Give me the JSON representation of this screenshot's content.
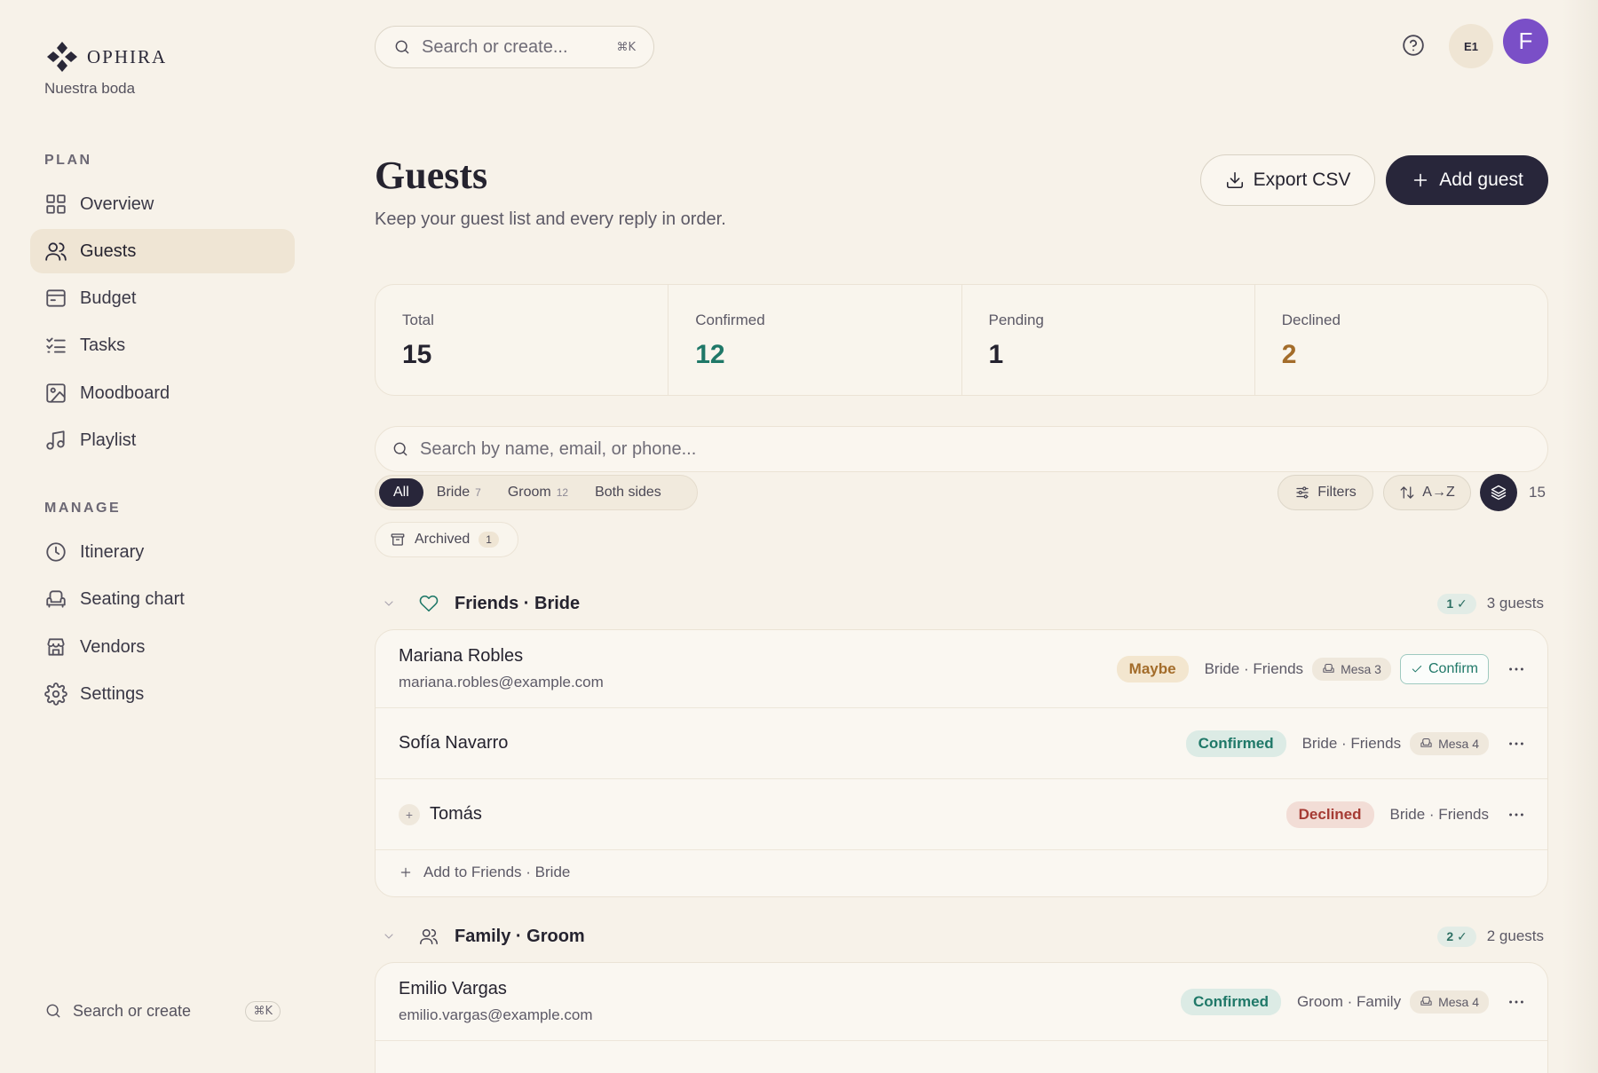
{
  "brand": {
    "name": "OPHIRA",
    "subtitle": "Nuestra boda"
  },
  "sidebar": {
    "plan_label": "PLAN",
    "manage_label": "MANAGE",
    "plan_items": [
      {
        "label": "Overview",
        "icon": "grid-icon"
      },
      {
        "label": "Guests",
        "icon": "users-icon",
        "active": true
      },
      {
        "label": "Budget",
        "icon": "wallet-icon"
      },
      {
        "label": "Tasks",
        "icon": "checklist-icon"
      },
      {
        "label": "Moodboard",
        "icon": "image-icon"
      },
      {
        "label": "Playlist",
        "icon": "music-icon"
      }
    ],
    "manage_items": [
      {
        "label": "Itinerary",
        "icon": "clock-icon"
      },
      {
        "label": "Seating chart",
        "icon": "armchair-icon"
      },
      {
        "label": "Vendors",
        "icon": "store-icon"
      },
      {
        "label": "Settings",
        "icon": "gear-icon"
      }
    ],
    "search_label": "Search or create",
    "search_shortcut": "⌘K"
  },
  "topbar": {
    "search_placeholder": "Search or create...",
    "search_shortcut": "⌘K",
    "workspace_badge": "E1",
    "avatar_initial": "F",
    "avatar_color": "#7a4fc7"
  },
  "header": {
    "title": "Guests",
    "subtitle": "Keep your guest list and every reply in order.",
    "export_label": "Export CSV",
    "add_label": "Add guest"
  },
  "stats": [
    {
      "label": "Total",
      "value": "15",
      "color": "#25232f"
    },
    {
      "label": "Confirmed",
      "value": "12",
      "color": "#1f7868"
    },
    {
      "label": "Pending",
      "value": "1",
      "color": "#25232f"
    },
    {
      "label": "Declined",
      "value": "2",
      "color": "#a36c2a"
    }
  ],
  "filters": {
    "search_placeholder": "Search by name, email, or phone...",
    "segments": [
      {
        "label": "All",
        "count": "",
        "active": true
      },
      {
        "label": "Bride",
        "count": "7"
      },
      {
        "label": "Groom",
        "count": "12"
      },
      {
        "label": "Both sides",
        "count": ""
      }
    ],
    "filters_label": "Filters",
    "sort_label": "A→Z",
    "result_count": "15",
    "archived_label": "Archived",
    "archived_count": "1"
  },
  "groups": [
    {
      "title": "Friends · Bride",
      "icon": "heart-icon",
      "confirmed_badge": "1 ✓",
      "count_label": "3 guests",
      "guests": [
        {
          "name": "Mariana Robles",
          "email": "mariana.robles@example.com",
          "status": "Maybe",
          "status_kind": "maybe",
          "tag": "Bride · Friends",
          "table": "Mesa 3",
          "confirm_label": "Confirm"
        },
        {
          "name": "Sofía Navarro",
          "email": "",
          "status": "Confirmed",
          "status_kind": "confirmed",
          "tag": "Bride · Friends",
          "table": "Mesa 4"
        },
        {
          "name": "Tomás",
          "email": "",
          "status": "Declined",
          "status_kind": "declined",
          "tag": "Bride · Friends",
          "table": "",
          "plus_one": true
        }
      ],
      "add_label": "Add to Friends · Bride"
    },
    {
      "title": "Family · Groom",
      "icon": "users-icon",
      "confirmed_badge": "2 ✓",
      "count_label": "2 guests",
      "guests": [
        {
          "name": "Emilio Vargas",
          "email": "emilio.vargas@example.com",
          "status": "Confirmed",
          "status_kind": "confirmed",
          "tag": "Groom · Family",
          "table": "Mesa 4"
        }
      ]
    }
  ]
}
